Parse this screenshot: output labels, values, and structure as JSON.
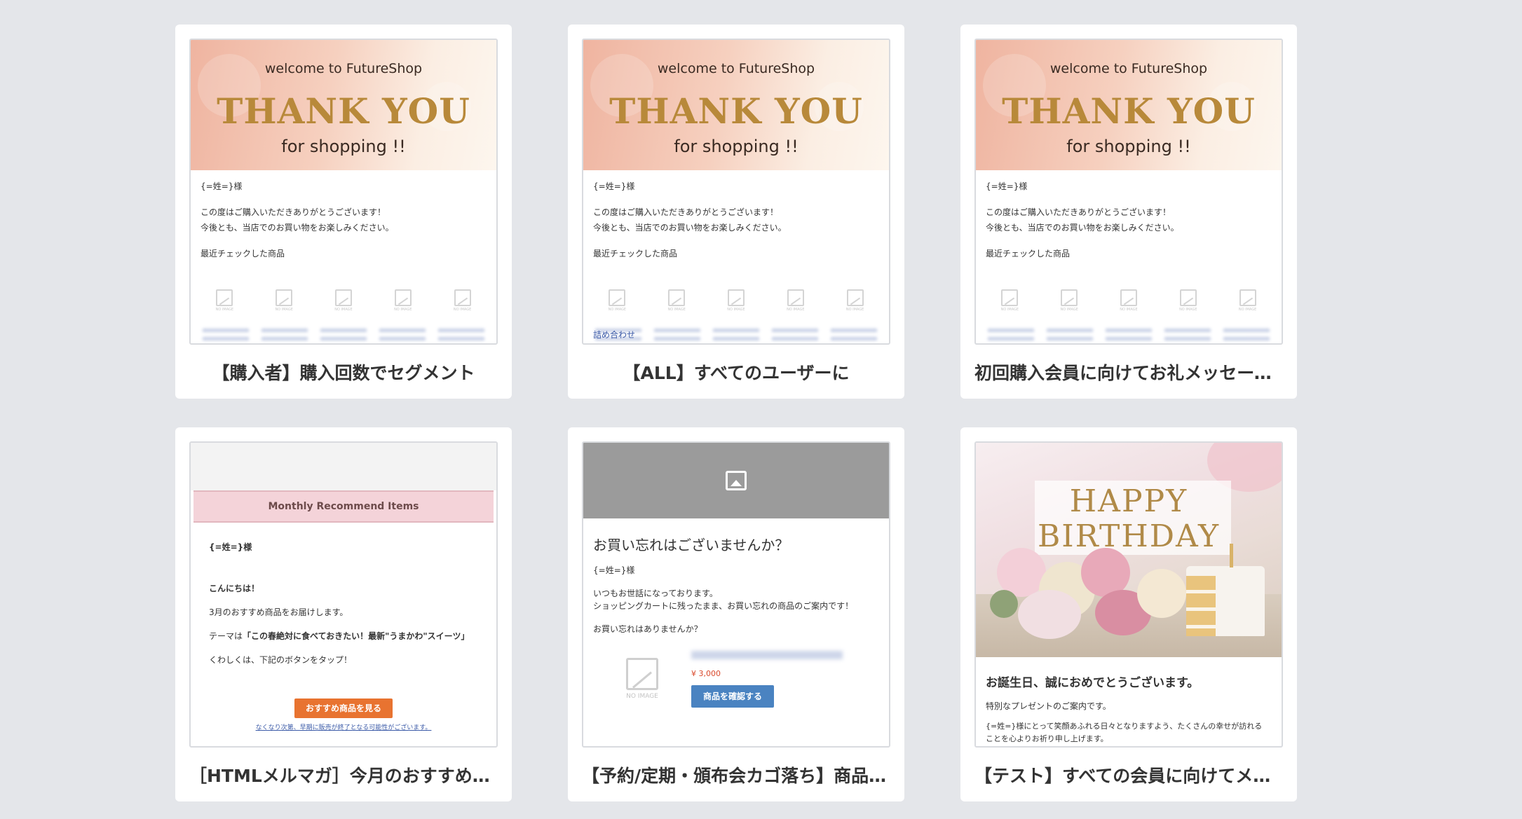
{
  "cards": [
    {
      "title": "【購入者】購入回数でセグメント",
      "preview": {
        "welcome": "welcome to FutureShop",
        "headline": "THANK YOU",
        "sub": "for shopping !!",
        "salutation": "{=姓=}様",
        "message_line1": "この度はご購入いただきありがとうございます！",
        "message_line2": "今後とも、当店でのお買い物をお楽しみください。",
        "recent_label": "最近チェックした商品",
        "noimage_caption": "NO IMAGE"
      }
    },
    {
      "title": "【ALL】すべてのユーザーに",
      "preview": {
        "welcome": "welcome to FutureShop",
        "headline": "THANK YOU",
        "sub": "for shopping !!",
        "salutation": "{=姓=}様",
        "message_line1": "この度はご購入いただきありがとうございます！",
        "message_line2": "今後とも、当店でのお買い物をお楽しみください。",
        "recent_label": "最近チェックした商品",
        "noimage_caption": "NO IMAGE",
        "link_text": "詰め合わせ"
      }
    },
    {
      "title": "初回購入会員に向けてお礼メッセージ...",
      "preview": {
        "welcome": "welcome to FutureShop",
        "headline": "THANK YOU",
        "sub": "for shopping !!",
        "salutation": "{=姓=}様",
        "message_line1": "この度はご購入いただきありがとうございます！",
        "message_line2": "今後とも、当店でのお買い物をお楽しみください。",
        "recent_label": "最近チェックした商品",
        "noimage_caption": "NO IMAGE"
      }
    },
    {
      "title": "［HTMLメルマガ］今月のおすすめ商品",
      "preview": {
        "band": "Monthly Recommend Items",
        "salutation": "{=姓=}様",
        "greeting": "こんにちは！",
        "line1": "3月のおすすめ商品をお届けします。",
        "theme_prefix": "テーマは",
        "theme": "「この春絶対に食べておきたい！最新\"うまかわ\"スイーツ」",
        "line3": "くわしくは、下記のボタンをタップ！",
        "button": "おすすめ商品を見る",
        "note": "なくなり次第、早期に販売が終了となる可能性がございます。"
      }
    },
    {
      "title": "【予約/定期・頒布会カゴ落ち】商品の...",
      "preview": {
        "heading": "お買い忘れはございませんか？",
        "salutation": "{=姓=}様",
        "line1": "いつもお世話になっております。",
        "line2": "ショッピングカートに残ったまま、お買い忘れの商品のご案内です！",
        "line3": "お買い忘れはありませんか？",
        "noimage_caption": "NO IMAGE",
        "price": "¥ 3,000",
        "button": "商品を確認する"
      }
    },
    {
      "title": "【テスト】すべての会員に向けてメッ...",
      "preview": {
        "happy": "HAPPY",
        "birthday": "BIRTHDAY",
        "heading": "お誕生日、誠におめでとうございます。",
        "line1": "特別なプレゼントのご案内です。",
        "line2": "{=姓=}様にとって笑顔あふれる日々となりますよう、たくさんの幸せが訪れる",
        "line3": "ことを心よりお祈り申し上げます。"
      }
    }
  ]
}
